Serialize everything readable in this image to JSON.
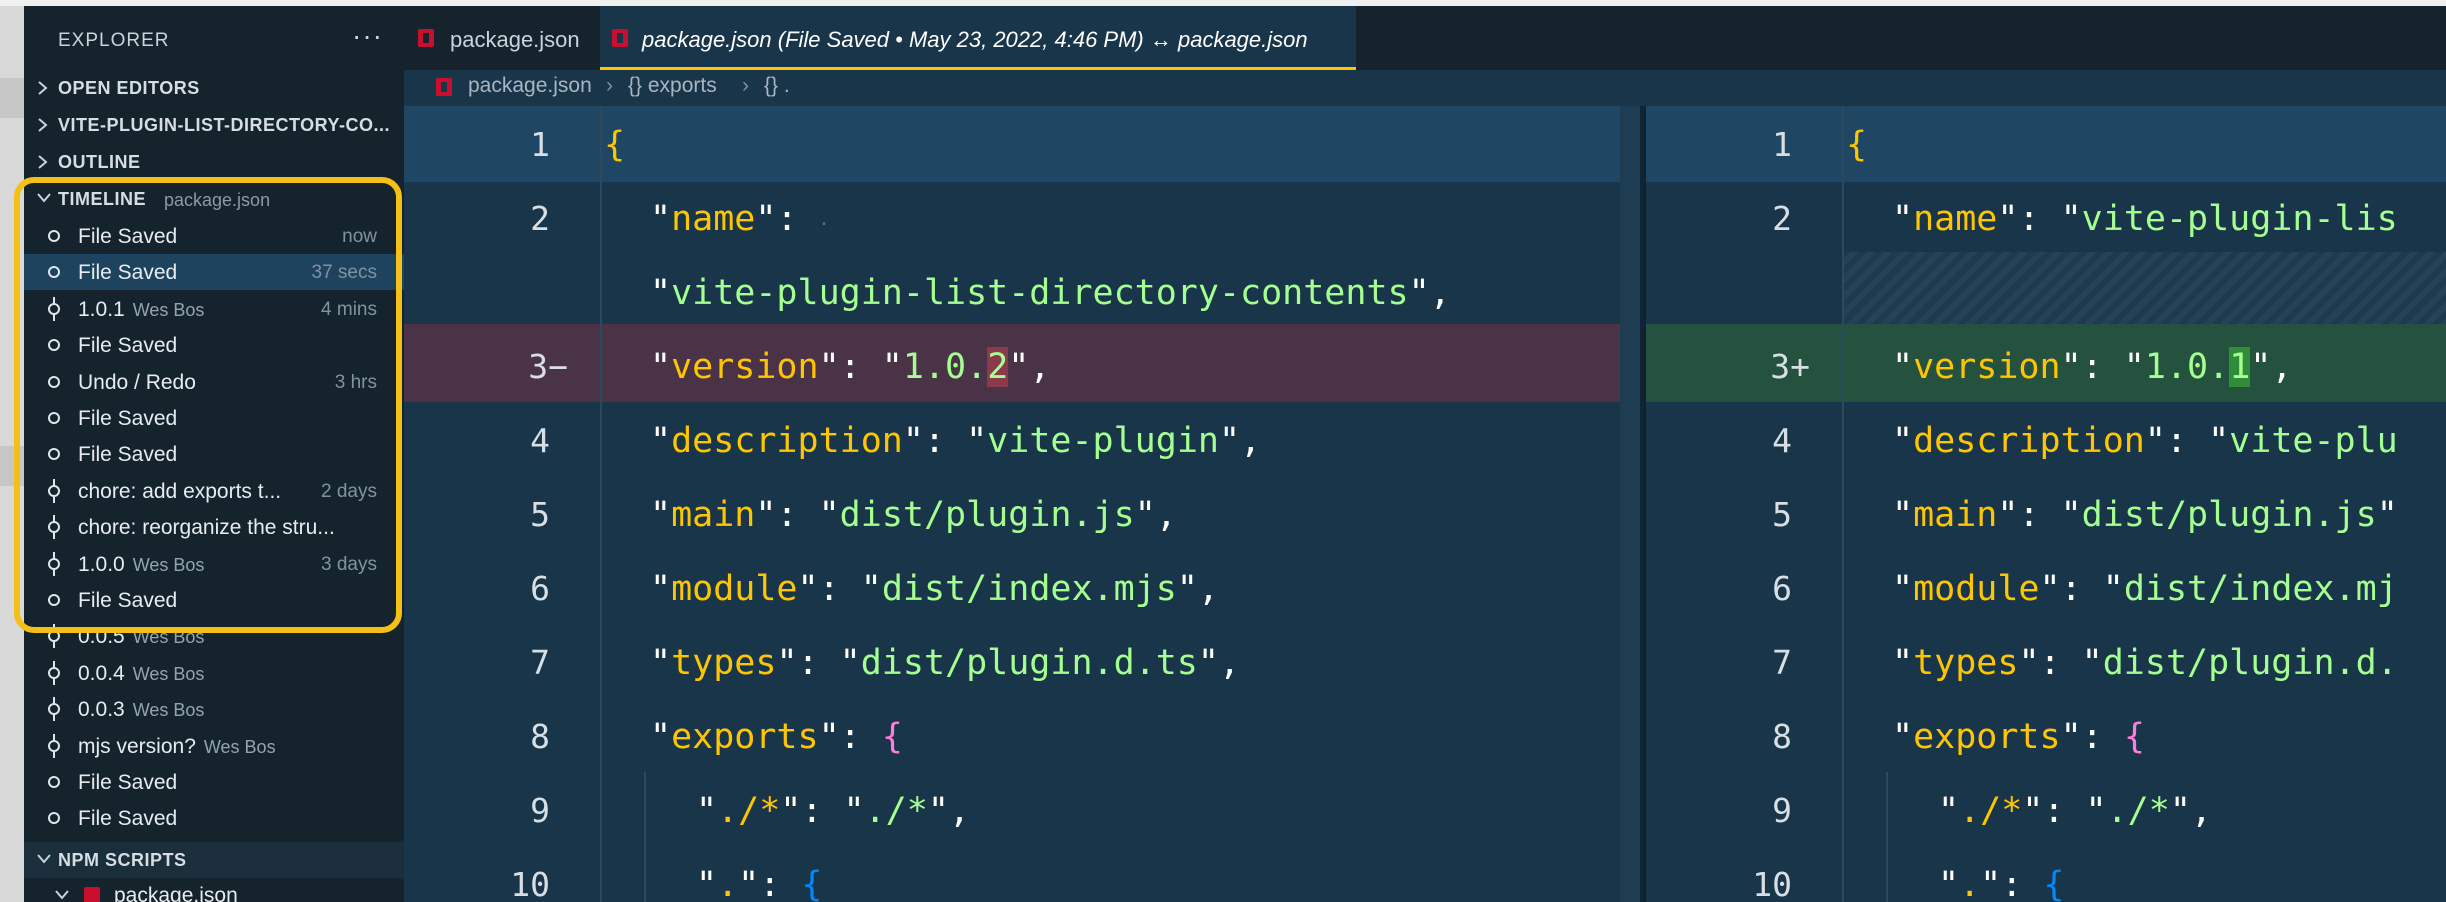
{
  "explorer": {
    "title": "EXPLORER",
    "more_icon": "ellipsis-icon",
    "sections": {
      "open_editors": "OPEN EDITORS",
      "project": "VITE-PLUGIN-LIST-DIRECTORY-CO...",
      "outline": "OUTLINE",
      "timeline": "TIMELINE",
      "timeline_file": "package.json",
      "npm_scripts": "NPM SCRIPTS",
      "npm_file": "package.json"
    }
  },
  "timeline": [
    {
      "label": "File Saved",
      "author": "",
      "when": "now",
      "icon": "circle-icon"
    },
    {
      "label": "File Saved",
      "author": "",
      "when": "37 secs",
      "icon": "circle-icon"
    },
    {
      "label": "1.0.1",
      "author": "Wes Bos",
      "when": "4 mins",
      "icon": "git-commit-icon"
    },
    {
      "label": "File Saved",
      "author": "",
      "when": "",
      "icon": "circle-icon"
    },
    {
      "label": "Undo / Redo",
      "author": "",
      "when": "3 hrs",
      "icon": "circle-icon"
    },
    {
      "label": "File Saved",
      "author": "",
      "when": "",
      "icon": "circle-icon"
    },
    {
      "label": "File Saved",
      "author": "",
      "when": "",
      "icon": "circle-icon"
    },
    {
      "label": "chore: add exports t...",
      "author": "",
      "when": "2 days",
      "icon": "git-commit-icon"
    },
    {
      "label": "chore: reorganize the stru...",
      "author": "",
      "when": "",
      "icon": "git-commit-icon"
    },
    {
      "label": "1.0.0",
      "author": "Wes Bos",
      "when": "3 days",
      "icon": "git-commit-icon"
    },
    {
      "label": "File Saved",
      "author": "",
      "when": "",
      "icon": "circle-icon"
    },
    {
      "label": "0.0.5",
      "author": "Wes Bos",
      "when": "",
      "icon": "git-commit-icon"
    },
    {
      "label": "0.0.4",
      "author": "Wes Bos",
      "when": "",
      "icon": "git-commit-icon"
    },
    {
      "label": "0.0.3",
      "author": "Wes Bos",
      "when": "",
      "icon": "git-commit-icon"
    },
    {
      "label": "mjs version?",
      "author": "Wes Bos",
      "when": "",
      "icon": "git-commit-icon"
    },
    {
      "label": "File Saved",
      "author": "",
      "when": "",
      "icon": "circle-icon"
    },
    {
      "label": "File Saved",
      "author": "",
      "when": "",
      "icon": "circle-icon"
    }
  ],
  "tabs": [
    {
      "label": "package.json",
      "icon": "npm-icon"
    },
    {
      "label": "package.json (File Saved • May 23, 2022, 4:46 PM) ↔ package.json",
      "icon": "npm-icon"
    }
  ],
  "breadcrumb": {
    "file": "package.json",
    "seg1": "{} exports",
    "seg2": "{} ."
  },
  "diff": {
    "left_numbers": [
      "1",
      "2",
      "",
      "3−",
      "4",
      "5",
      "6",
      "7",
      "8",
      "9",
      "10"
    ],
    "right_numbers": [
      "1",
      "2",
      "",
      "3+",
      "4",
      "5",
      "6",
      "7",
      "8",
      "9",
      "10"
    ],
    "left": {
      "name_key": "name",
      "name_value": "vite-plugin-list-directory-contents",
      "version_key": "version",
      "version_prefix": "1.0.",
      "version_changed": "2",
      "description_key": "description",
      "description_value": "vite-plugin",
      "main_key": "main",
      "main_value": "dist/plugin.js",
      "module_key": "module",
      "module_value": "dist/index.mjs",
      "types_key": "types",
      "types_value": "dist/plugin.d.ts",
      "exports_key": "exports",
      "star_key": "./*",
      "star_value": "./*",
      "dot_key": "."
    },
    "right": {
      "name_key": "name",
      "name_value": "vite-plugin-lis",
      "version_key": "version",
      "version_prefix": "1.0.",
      "version_changed": "1",
      "description_key": "description",
      "description_value": "vite-plu",
      "main_key": "main",
      "main_value": "dist/plugin.js",
      "module_key": "module",
      "module_value": "dist/index.mj",
      "types_key": "types",
      "types_value": "dist/plugin.d.",
      "exports_key": "exports",
      "star_key": "./*",
      "star_value": "./*",
      "dot_key": "."
    }
  },
  "colors": {
    "highlight": "#f5c016",
    "keyword": "#ffc600",
    "deleted_line": "#4a3346",
    "added_line": "#24523e",
    "background": "#193549"
  }
}
